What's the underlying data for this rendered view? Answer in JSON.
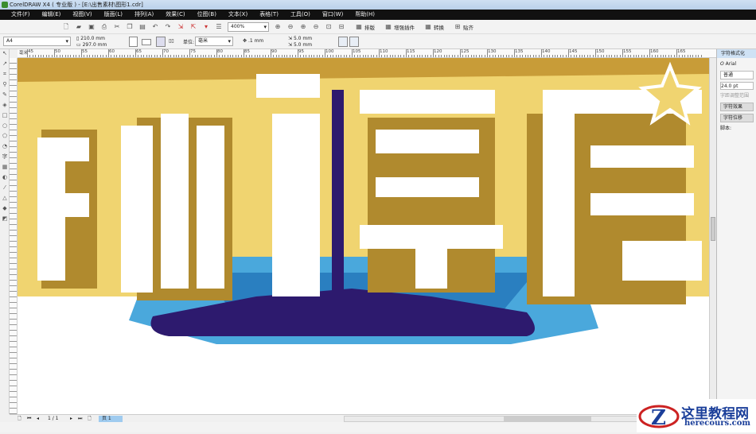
{
  "window": {
    "title": "CorelDRAW X4 ( 专业版 ) - [E:\\出售素材\\图形1.cdr]"
  },
  "menu": [
    "文件(F)",
    "编辑(E)",
    "视图(V)",
    "版面(L)",
    "排列(A)",
    "效果(C)",
    "位图(B)",
    "文本(X)",
    "表格(T)",
    "工具(O)",
    "窗口(W)",
    "帮助(H)"
  ],
  "toolbar": {
    "zoom": "400%",
    "buttons": [
      "排版",
      "增强插件",
      "转换",
      "贴齐"
    ]
  },
  "property_bar": {
    "page_size": "A4",
    "width": "210.0 mm",
    "height": "297.0 mm",
    "unit_label": "单位:",
    "unit": "毫米",
    "nudge": ".1 mm",
    "dup_x": "5.0 mm",
    "dup_y": "5.0 mm"
  },
  "ruler": {
    "unit": "毫米",
    "labels": [
      "45",
      "50",
      "55",
      "60",
      "65",
      "70",
      "75",
      "80",
      "85",
      "90",
      "95",
      "100",
      "105",
      "110",
      "115",
      "120",
      "125",
      "130",
      "135",
      "140",
      "145",
      "150",
      "155",
      "160",
      "165"
    ]
  },
  "docker": {
    "title": "字符格式化",
    "font": "Arial",
    "style": "普通",
    "size": "24.0 pt",
    "range_label": "字距调整范围",
    "effects": "字符效果",
    "offset": "字符位移",
    "script": "脚本:"
  },
  "status": {
    "page_counter": "1 / 1",
    "page_tab": "页 1"
  },
  "watermark": {
    "name": "这里教程网",
    "url": "herecours.com"
  },
  "colors": {
    "yellow": "#f0d470",
    "gold": "#b08a2e",
    "blue": "#4aa8dc",
    "navy": "#2d1a6e"
  }
}
